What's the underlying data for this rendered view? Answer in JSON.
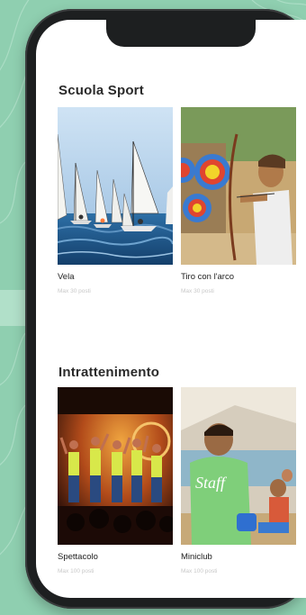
{
  "sections": [
    {
      "title": "Scuola Sport",
      "cards": [
        {
          "name": "Vela",
          "meta": "Max 30 posti",
          "image": "sailing-regatta"
        },
        {
          "name": "Tiro con l'arco",
          "meta": "Max 30 posti",
          "image": "archery-kid"
        }
      ]
    },
    {
      "title": "Intrattenimento",
      "cards": [
        {
          "name": "Spettacolo",
          "meta": "Max 100 posti",
          "image": "stage-show"
        },
        {
          "name": "Miniclub",
          "meta": "Max 100 posti",
          "image": "staff-with-kids"
        }
      ]
    }
  ],
  "colors": {
    "background": "#8fcfb0",
    "phone": "#1d1f20",
    "text": "#2a2a2a"
  }
}
